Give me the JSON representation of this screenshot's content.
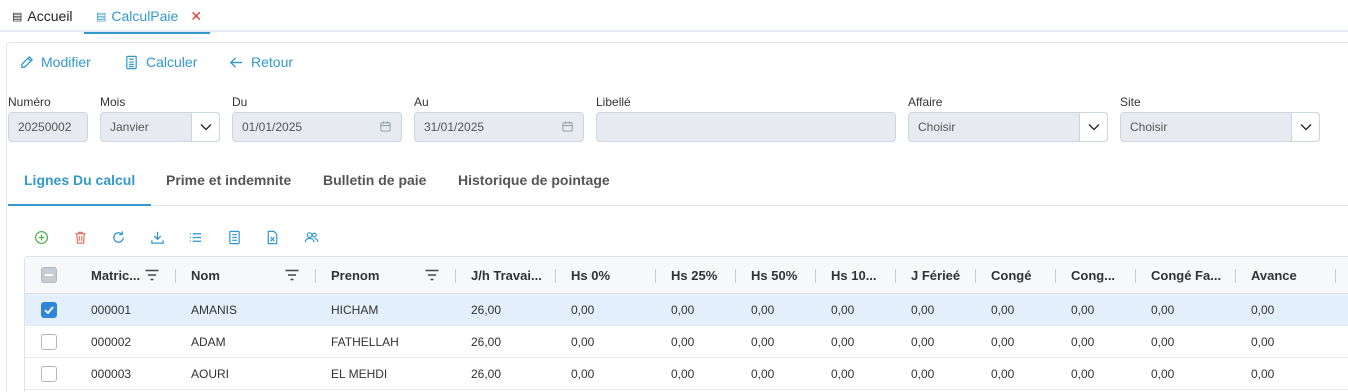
{
  "tabs": [
    {
      "label": "Accueil",
      "icon": "table-icon"
    },
    {
      "label": "CalculPaie",
      "icon": "table-icon",
      "active": true,
      "close": "✕"
    }
  ],
  "toolbar": {
    "modifier": "Modifier",
    "calculer": "Calculer",
    "retour": "Retour"
  },
  "form": {
    "numero_label": "Numéro",
    "numero_value": "20250002",
    "mois_label": "Mois",
    "mois_value": "Janvier",
    "du_label": "Du",
    "du_value": "01/01/2025",
    "au_label": "Au",
    "au_value": "31/01/2025",
    "libelle_label": "Libellé",
    "libelle_value": "",
    "affaire_label": "Affaire",
    "affaire_value": "Choisir",
    "site_label": "Site",
    "site_value": "Choisir"
  },
  "section_tabs": [
    "Lignes Du calcul",
    "Prime et indemnite",
    "Bulletin de paie",
    "Historique de pointage"
  ],
  "grid_actions": [
    "add-icon",
    "delete-icon",
    "refresh-icon",
    "download-icon",
    "list-icon",
    "document-icon",
    "excel-icon",
    "users-icon"
  ],
  "colors": {
    "accent": "#3399cc",
    "danger": "#e53935",
    "selected_row": "#e3f0fb",
    "checkbox": "#2f86d6"
  },
  "grid": {
    "columns": [
      "Matric...",
      "Nom",
      "Prenom",
      "J/h Travai...",
      "Hs 0%",
      "Hs 25%",
      "Hs 50%",
      "Hs 10...",
      "J Férieé",
      "Congé",
      "Cong...",
      "Congé Fa...",
      "Avance"
    ],
    "rows": [
      {
        "selected": true,
        "cells": [
          "000001",
          "AMANIS",
          "HICHAM",
          "26,00",
          "0,00",
          "0,00",
          "0,00",
          "0,00",
          "0,00",
          "0,00",
          "0,00",
          "0,00",
          "0,00"
        ]
      },
      {
        "selected": false,
        "cells": [
          "000002",
          "ADAM",
          "FATHELLAH",
          "26,00",
          "0,00",
          "0,00",
          "0,00",
          "0,00",
          "0,00",
          "0,00",
          "0,00",
          "0,00",
          "0,00"
        ]
      },
      {
        "selected": false,
        "cells": [
          "000003",
          "AOURI",
          "EL MEHDI",
          "26,00",
          "0,00",
          "0,00",
          "0,00",
          "0,00",
          "0,00",
          "0,00",
          "0,00",
          "0,00",
          "0,00"
        ]
      }
    ]
  }
}
